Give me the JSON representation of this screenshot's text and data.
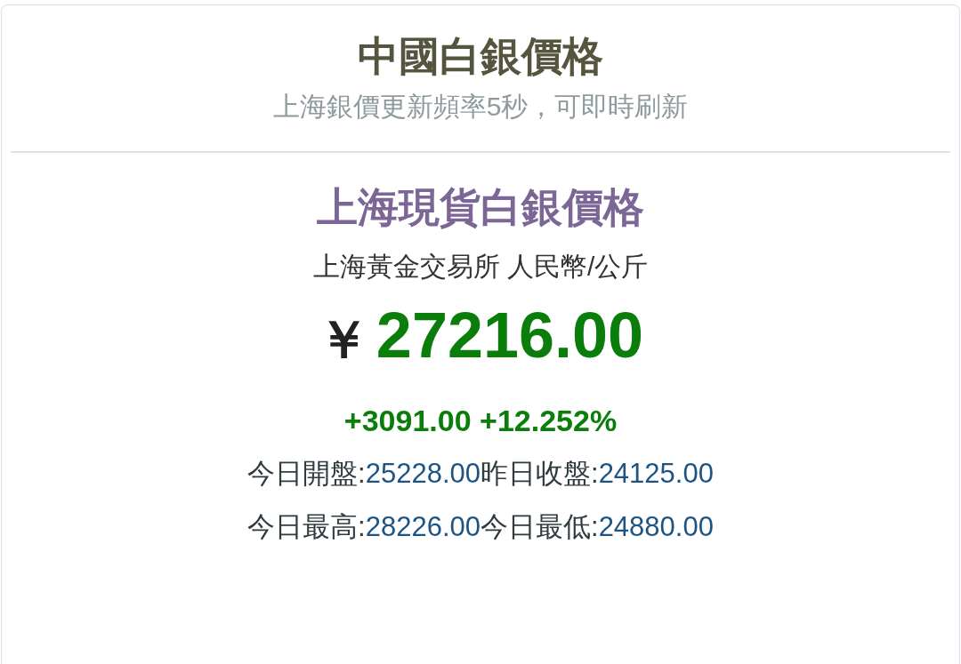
{
  "header": {
    "title": "中國白銀價格",
    "subtitle": "上海銀價更新頻率5秒，可即時刷新"
  },
  "quote": {
    "title": "上海現貨白銀價格",
    "source": "上海黃金交易所 人民幣/公斤",
    "currency": "￥",
    "price": "27216.00",
    "change": "+3091.00 +12.252%",
    "stats": [
      [
        {
          "label": "今日開盤:",
          "value": "25228.00"
        },
        {
          "label": "昨日收盤:",
          "value": "24125.00"
        }
      ],
      [
        {
          "label": "今日最高:",
          "value": "28226.00"
        },
        {
          "label": "今日最低:",
          "value": "24880.00"
        }
      ]
    ]
  }
}
